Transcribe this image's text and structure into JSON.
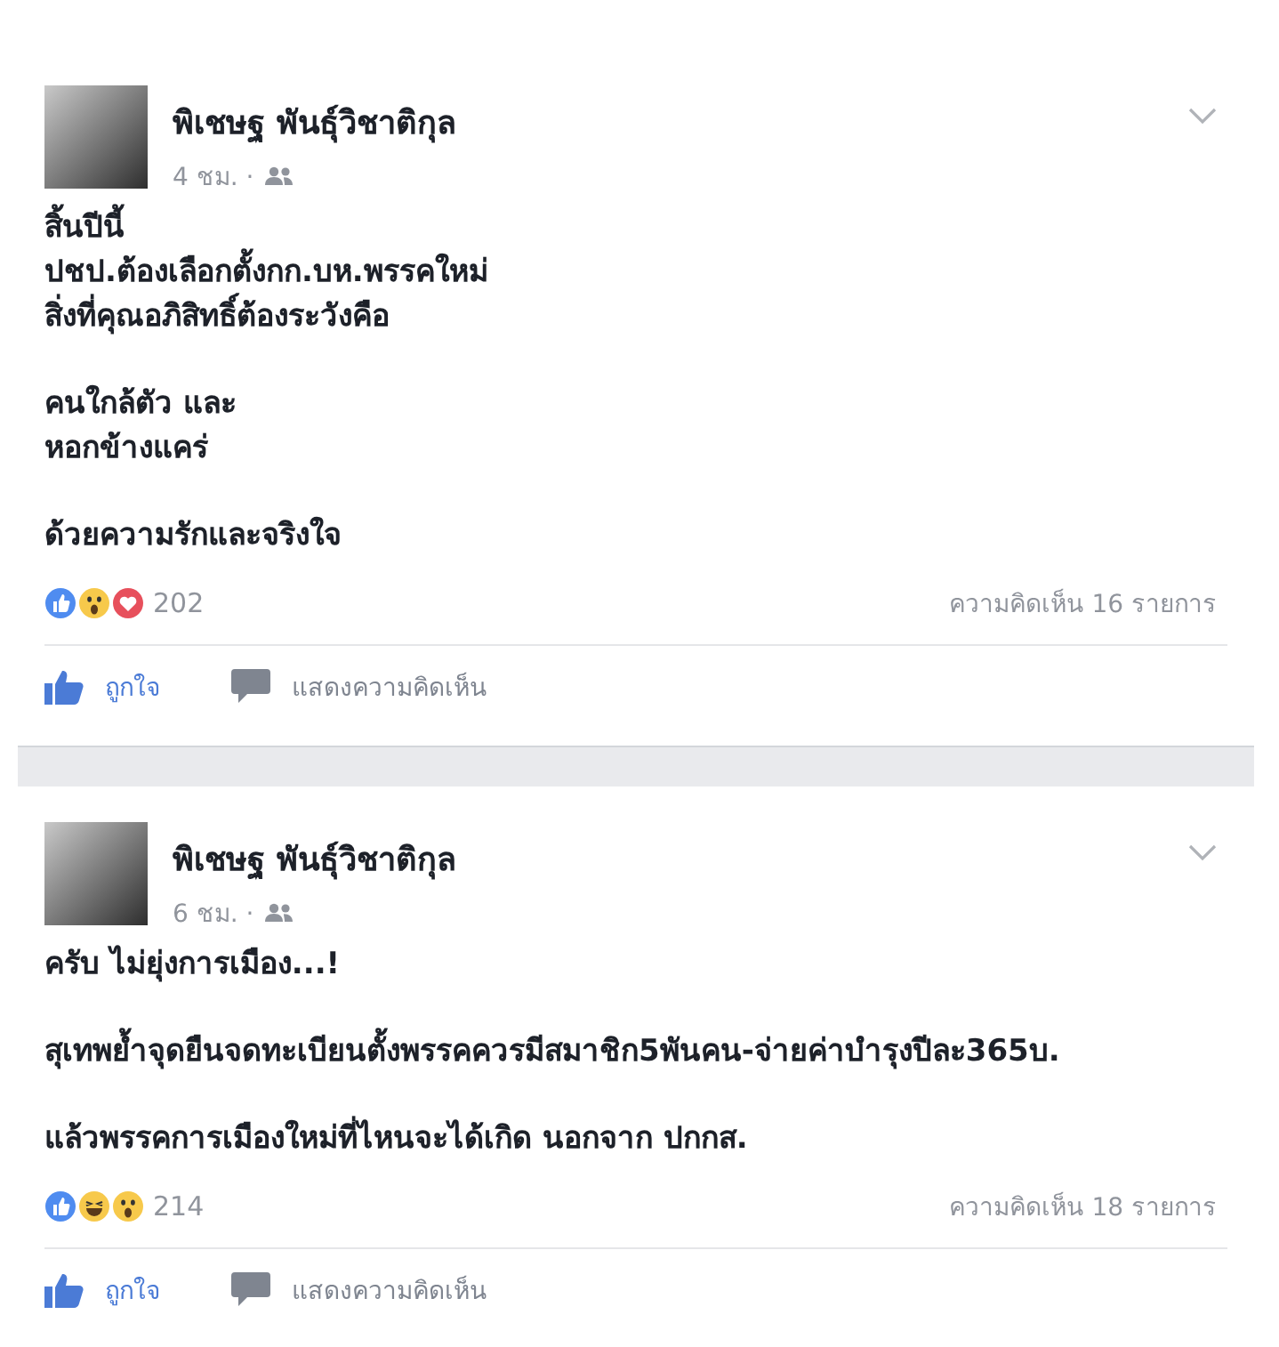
{
  "posts": [
    {
      "author": "พิเชษฐ พันธุ์วิชาติกุล",
      "time": "4 ชม. ·",
      "paragraphs": [
        "สิ้นปีนี้\nปชป.ต้องเลือกตั้งกก.บห.พรรคใหม่\nสิ่งที่คุณอภิสิทธิ์ต้องระวังคือ",
        "คนใกล้ตัว และ\nหอกข้างแคร่",
        "ด้วยความรักและจริงใจ"
      ],
      "reactions": [
        {
          "kind": "like"
        },
        {
          "kind": "wow"
        },
        {
          "kind": "love"
        }
      ],
      "reaction_count": "202",
      "comments": "ความคิดเห็น 16 รายการ",
      "actions": [
        {
          "kind": "like",
          "label": "ถูกใจ"
        },
        {
          "kind": "comment",
          "label": "แสดงความคิดเห็น"
        }
      ]
    },
    {
      "author": "พิเชษฐ พันธุ์วิชาติกุล",
      "time": "6 ชม. ·",
      "paragraphs": [
        "ครับ ไม่ยุ่งการเมือง...!",
        "สุเทพย้ำจุดยืนจดทะเบียนตั้งพรรคควรมีสมาชิก5พันคน-จ่ายค่าบำรุงปีละ365บ.",
        "แล้วพรรคการเมืองใหม่ที่ไหนจะได้เกิด  นอกจาก ปกกส."
      ],
      "reactions": [
        {
          "kind": "like"
        },
        {
          "kind": "haha"
        },
        {
          "kind": "wow"
        }
      ],
      "reaction_count": "214",
      "comments": "ความคิดเห็น 18 รายการ",
      "actions": [
        {
          "kind": "like",
          "label": "ถูกใจ"
        },
        {
          "kind": "comment",
          "label": "แสดงความคิดเห็น"
        }
      ]
    }
  ]
}
